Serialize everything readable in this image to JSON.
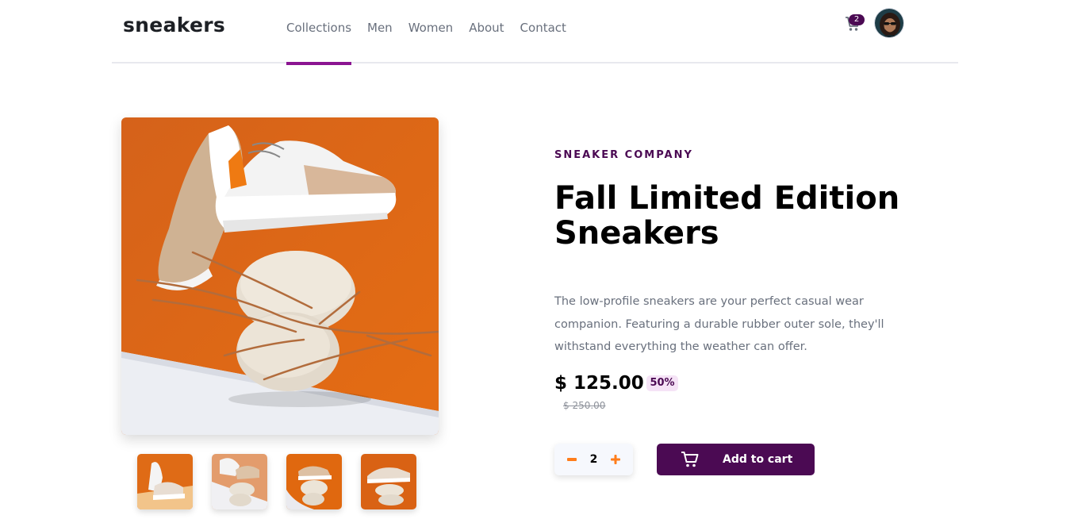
{
  "header": {
    "logo": "sneakers",
    "nav": [
      "Collections",
      "Men",
      "Women",
      "About",
      "Contact"
    ],
    "active_nav": "Collections",
    "cart_count": "2",
    "icons": {
      "cart": "cart-icon",
      "avatar": "avatar"
    }
  },
  "gallery": {
    "main": "product-image",
    "thumbnails": [
      "thumbnail-1",
      "thumbnail-2",
      "thumbnail-3",
      "thumbnail-4"
    ]
  },
  "product": {
    "company": "SNEAKER COMPANY",
    "title": "Fall Limited Edition Sneakers",
    "description": "The low-profile sneakers are your perfect casual wear companion. Featuring a durable rubber outer sole, they'll withstand everything the weather can offer.",
    "price": "$ 125.00",
    "discount": "50%",
    "original_price": "$ 250.00"
  },
  "cart_controls": {
    "quantity": "2",
    "add_label": "Add to cart"
  },
  "colors": {
    "accent": "#4b0a53",
    "active_underline": "#8b1591",
    "orange": "#ff7d1a",
    "text_muted": "#69707d"
  }
}
